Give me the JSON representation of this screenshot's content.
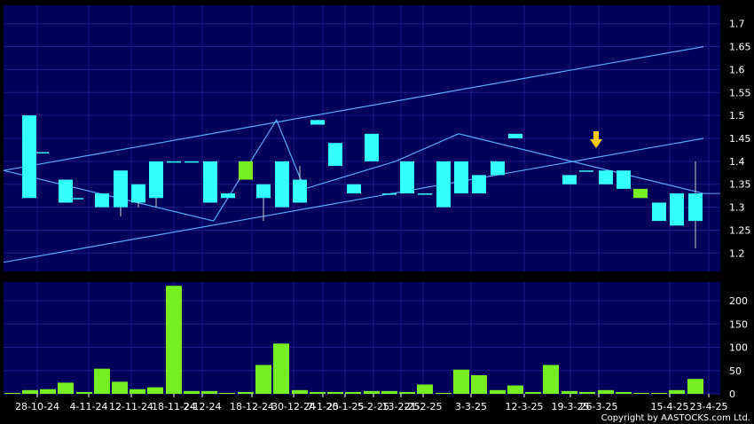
{
  "copyright": "Copyright by AASTOCKS.com Ltd.",
  "colors": {
    "background": "#000000",
    "panel": "#00005a",
    "grid": "#1c1c8a",
    "up_candle": "#33ffff",
    "down_candle": "#77ee22",
    "volume_bar": "#77ee22",
    "trendline": "#55aaff",
    "marker": "#ffcc00"
  },
  "chart_data": [
    {
      "type": "candlestick",
      "ylim": [
        1.16,
        1.74
      ],
      "yticks": [
        1.2,
        1.25,
        1.3,
        1.35,
        1.4,
        1.45,
        1.5,
        1.55,
        1.6,
        1.65,
        1.7
      ],
      "grid": true,
      "marker": {
        "type": "down-arrow",
        "index": 39
      },
      "candles": [
        {
          "o": 1.32,
          "h": 1.5,
          "l": 1.32,
          "c": 1.5,
          "up": true
        },
        {
          "o": 1.42,
          "h": 1.42,
          "l": 1.42,
          "c": 1.42,
          "up": true
        },
        {
          "o": 1.31,
          "h": 1.36,
          "l": 1.31,
          "c": 1.36,
          "up": true
        },
        {
          "o": 1.32,
          "h": 1.32,
          "l": 1.32,
          "c": 1.32,
          "up": true
        },
        {
          "o": 1.3,
          "h": 1.33,
          "l": 1.3,
          "c": 1.33,
          "up": true
        },
        {
          "o": 1.3,
          "h": 1.38,
          "l": 1.28,
          "c": 1.38,
          "up": true
        },
        {
          "o": 1.31,
          "h": 1.35,
          "l": 1.3,
          "c": 1.35,
          "up": true
        },
        {
          "o": 1.32,
          "h": 1.4,
          "l": 1.3,
          "c": 1.4,
          "up": true
        },
        {
          "o": 1.4,
          "h": 1.4,
          "l": 1.4,
          "c": 1.4,
          "up": true
        },
        {
          "o": 1.4,
          "h": 1.4,
          "l": 1.4,
          "c": 1.4,
          "up": true
        },
        {
          "o": 1.31,
          "h": 1.4,
          "l": 1.31,
          "c": 1.4,
          "up": true
        },
        {
          "o": 1.32,
          "h": 1.33,
          "l": 1.32,
          "c": 1.33,
          "up": true
        },
        {
          "o": 1.4,
          "h": 1.4,
          "l": 1.36,
          "c": 1.36,
          "up": false
        },
        {
          "o": 1.32,
          "h": 1.35,
          "l": 1.27,
          "c": 1.35,
          "up": true
        },
        {
          "o": 1.3,
          "h": 1.4,
          "l": 1.3,
          "c": 1.4,
          "up": true
        },
        {
          "o": 1.31,
          "h": 1.39,
          "l": 1.31,
          "c": 1.36,
          "up": true
        },
        {
          "o": 1.48,
          "h": 1.49,
          "l": 1.48,
          "c": 1.49,
          "up": true
        },
        {
          "o": 1.39,
          "h": 1.44,
          "l": 1.39,
          "c": 1.44,
          "up": true
        },
        {
          "o": 1.33,
          "h": 1.35,
          "l": 1.33,
          "c": 1.35,
          "up": true
        },
        {
          "o": 1.4,
          "h": 1.46,
          "l": 1.4,
          "c": 1.46,
          "up": true
        },
        {
          "o": 1.33,
          "h": 1.33,
          "l": 1.33,
          "c": 1.33,
          "up": true
        },
        {
          "o": 1.33,
          "h": 1.4,
          "l": 1.33,
          "c": 1.4,
          "up": true
        },
        {
          "o": 1.33,
          "h": 1.33,
          "l": 1.33,
          "c": 1.33,
          "up": true
        },
        {
          "o": 1.3,
          "h": 1.4,
          "l": 1.3,
          "c": 1.4,
          "up": true
        },
        {
          "o": 1.33,
          "h": 1.4,
          "l": 1.33,
          "c": 1.4,
          "up": true
        },
        {
          "o": 1.33,
          "h": 1.37,
          "l": 1.33,
          "c": 1.37,
          "up": true
        },
        {
          "o": 1.37,
          "h": 1.4,
          "l": 1.37,
          "c": 1.4,
          "up": true
        },
        {
          "o": 1.45,
          "h": 1.46,
          "l": 1.45,
          "c": 1.46,
          "up": true
        },
        {
          "o": 1.35,
          "h": 1.37,
          "l": 1.35,
          "c": 1.37,
          "up": true
        },
        {
          "o": 1.38,
          "h": 1.38,
          "l": 1.38,
          "c": 1.38,
          "up": true
        },
        {
          "o": 1.35,
          "h": 1.38,
          "l": 1.35,
          "c": 1.38,
          "up": true
        },
        {
          "o": 1.34,
          "h": 1.38,
          "l": 1.34,
          "c": 1.38,
          "up": true
        },
        {
          "o": 1.34,
          "h": 1.34,
          "l": 1.32,
          "c": 1.32,
          "up": false
        },
        {
          "o": 1.27,
          "h": 1.31,
          "l": 1.27,
          "c": 1.31,
          "up": true
        },
        {
          "o": 1.26,
          "h": 1.33,
          "l": 1.26,
          "c": 1.33,
          "up": true
        },
        {
          "o": 1.27,
          "h": 1.4,
          "l": 1.21,
          "c": 1.33,
          "up": true
        }
      ],
      "candle_x": [
        33,
        47,
        74,
        86,
        115,
        136,
        156,
        176,
        196,
        216,
        237,
        257,
        277,
        297,
        318,
        338,
        358,
        378,
        399,
        419,
        439,
        459,
        479,
        500,
        520,
        540,
        561,
        581,
        642,
        661,
        683,
        703,
        722,
        743,
        763,
        784
      ],
      "trendlines": [
        {
          "points": [
            [
              0,
              1.38
            ],
            [
              1,
              1.65
            ]
          ]
        },
        {
          "points": [
            [
              0,
              1.18
            ],
            [
              1,
              1.45
            ]
          ]
        },
        {
          "points": [
            [
              0,
              1.38
            ],
            [
              0.3,
              1.27
            ],
            [
              0.39,
              1.49
            ],
            [
              0.43,
              1.34
            ],
            [
              0.56,
              1.4
            ],
            [
              0.65,
              1.46
            ],
            [
              1,
              1.33
            ]
          ]
        }
      ]
    },
    {
      "type": "bar",
      "ylim": [
        0,
        240
      ],
      "yticks": [
        0,
        50,
        100,
        150,
        200
      ],
      "grid": true,
      "values": [
        2,
        8,
        10,
        24,
        4,
        54,
        26,
        10,
        14,
        232,
        6,
        6,
        2,
        4,
        62,
        108,
        8,
        4,
        4,
        4,
        6,
        6,
        4,
        20,
        2,
        52,
        40,
        8,
        18,
        4,
        62,
        6,
        4,
        8,
        4,
        2,
        2,
        8,
        32
      ],
      "bar_x": [
        14,
        34,
        54,
        74,
        95,
        115,
        135,
        155,
        175,
        196,
        216,
        236,
        256,
        277,
        297,
        317,
        338,
        358,
        378,
        398,
        419,
        439,
        459,
        479,
        500,
        520,
        540,
        561,
        581,
        601,
        621,
        642,
        662,
        683,
        703,
        723,
        743,
        763,
        784
      ]
    }
  ],
  "x_tick_labels": [
    "28-10-24",
    "4-11-24",
    "12-11-24",
    "18-11-24",
    "2-12-24",
    "18-12-24",
    "30-12-24",
    "7-1-25",
    "20-1-25",
    "5-2-25",
    "13-2-25",
    "21-2-25",
    "3-3-25",
    "12-3-25",
    "19-3-25",
    "26-3-25",
    "15-4-25",
    "23-4-25"
  ],
  "x_tick_positions": [
    42,
    100,
    148,
    196,
    228,
    284,
    331,
    364,
    389,
    421,
    452,
    477,
    531,
    591,
    643,
    675,
    755,
    799
  ]
}
